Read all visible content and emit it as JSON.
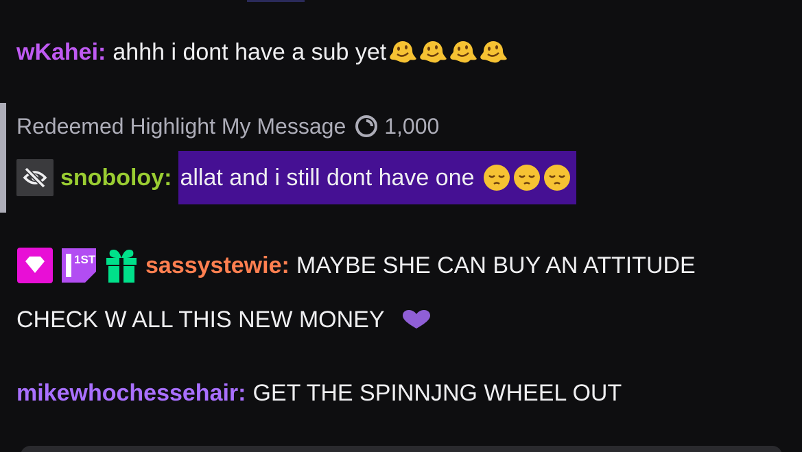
{
  "messages": [
    {
      "username": "wKahei",
      "user_color": "#bf5af2",
      "text": "ahhh i dont have a sub yet",
      "emoji_name": "melting-face-icon",
      "emoji_count": 4
    },
    {
      "redeem_label": "Redeemed Highlight My Message",
      "points": "1,000",
      "username": "snoboloy",
      "user_color": "#9acd32",
      "text": "allat and i still dont have one",
      "emoji_name": "pensive-face-icon",
      "highlight_color": "#451093"
    },
    {
      "username": "sassystewie",
      "user_color": "#ff7f50",
      "text_line1": "MAYBE SHE CAN BUY AN ATTITUDE",
      "text_line2": "CHECK W ALL THIS NEW MONEY",
      "badges": [
        "diamond-badge-icon",
        "first-badge-icon",
        "gift-badge-icon"
      ],
      "first_badge_text": "1ST",
      "heart_emote": "purple-heart-icon"
    },
    {
      "username": "mikewhochessehair",
      "user_color": "#a970ff",
      "text": "GET THE SPINNJNG WHEEL OUT"
    }
  ]
}
